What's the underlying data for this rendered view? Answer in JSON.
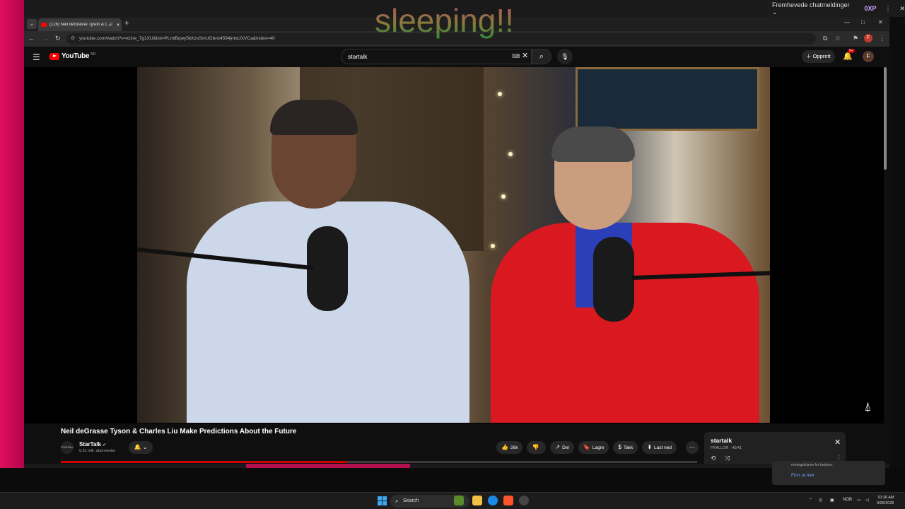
{
  "overlay": {
    "text": "sleeping!!"
  },
  "chat_widget": {
    "label": "Fremhevede chatmeldinger ⌄",
    "xp_label": "0XP",
    "more_icon": "⋮",
    "close_icon": "✕"
  },
  "browser": {
    "tab": {
      "title": "(128) Neil deGrasse Tyson & Charle",
      "audio_icon": "🔊",
      "close": "✕"
    },
    "new_tab": "+",
    "tab_list_icon": "⌄",
    "window_controls": {
      "minimize": "—",
      "maximize": "□",
      "close": "✕"
    },
    "url": "youtube.com/watch?v=id1re_7g1XU&list=PLmlBqwy5kKzsSmUGbnx4594jnlotJXVCa&index=40",
    "profile_initial": "F"
  },
  "youtube": {
    "logo_text": "YouTube",
    "region": "NO",
    "search_value": "startalk",
    "create_label": "Opprett",
    "notification_badge": "9+",
    "avatar_initial": "F"
  },
  "video": {
    "title": "Neil deGrasse Tyson & Charles Liu Make Predictions About the Future",
    "channel": {
      "name": "StarTalk",
      "avatar_text": "STARTALK",
      "verified_icon": "✔",
      "subscribers": "5,51 mill. abonnenter"
    },
    "progress": 0.45,
    "actions": [
      {
        "icon": "👍",
        "label": "26k",
        "name": "like-button"
      },
      {
        "icon": "👎",
        "label": "",
        "name": "dislike-button"
      },
      {
        "icon": "↗",
        "label": "Del",
        "name": "share-button"
      },
      {
        "icon": "🔖",
        "label": "Lagre",
        "name": "save-button"
      },
      {
        "icon": "$",
        "label": "Takk",
        "name": "thanks-button"
      },
      {
        "icon": "⬇",
        "label": "Last ned",
        "name": "download-button"
      }
    ],
    "more_icon": "⋯"
  },
  "playlist": {
    "title": "startalk",
    "subtitle": "FRALLOR · 40/41"
  },
  "toast": {
    "text": "retningslinjene for brukere.",
    "link": "Finn ut mer"
  },
  "taskbar": {
    "search_placeholder": "Search",
    "language": "NOB",
    "time": "10:26 AM",
    "date": "3/26/2026"
  },
  "colors": {
    "accent_red": "#cc0000",
    "desktop_pink": "#e0105f",
    "link_blue": "#6ca8ff"
  }
}
